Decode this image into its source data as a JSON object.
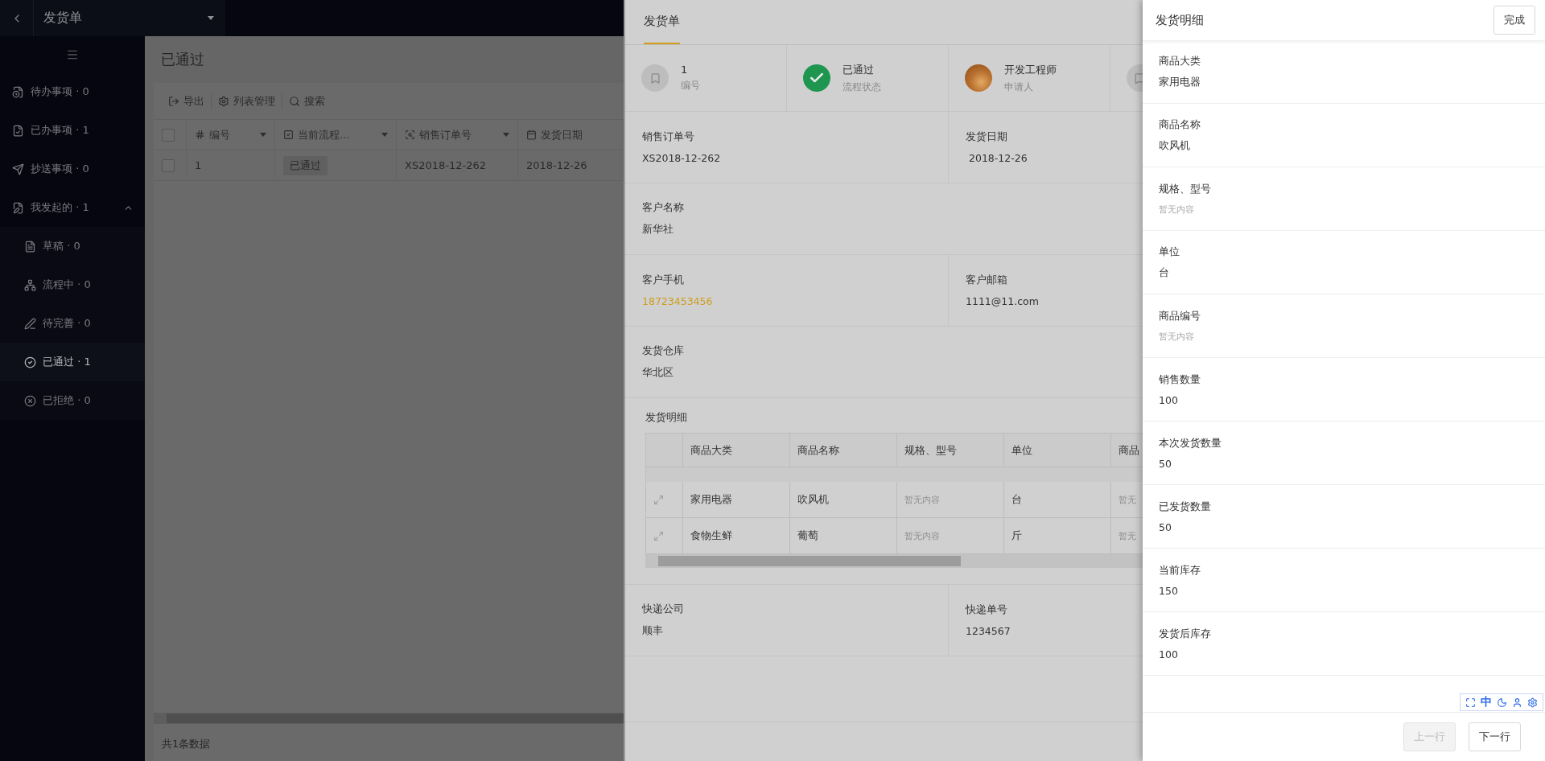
{
  "app_bar": {
    "title": "发货单"
  },
  "sidebar": {
    "items": [
      {
        "label": "待办事项 · 0",
        "selected": false
      },
      {
        "label": "已办事项 · 1",
        "selected": false
      },
      {
        "label": "抄送事项 · 0",
        "selected": false
      },
      {
        "label": "我发起的 · 1",
        "selected": false,
        "expanded": true,
        "children": [
          {
            "label": "草稿 · 0",
            "selected": false
          },
          {
            "label": "流程中 · 0",
            "selected": false
          },
          {
            "label": "待完善 · 0",
            "selected": false
          },
          {
            "label": "已通过 · 1",
            "selected": true
          },
          {
            "label": "已拒绝 · 0",
            "selected": false
          }
        ]
      }
    ]
  },
  "list_page": {
    "title": "已通过",
    "toolbar": [
      "导出",
      "列表管理",
      "搜索"
    ],
    "table": {
      "all_checked": false,
      "columns": [
        "编号",
        "当前流程...",
        "销售订单号",
        "发货日期"
      ],
      "rows": [
        {
          "checked": false,
          "cells": [
            "1",
            "已通过",
            "XS2018-12-262",
            "2018-12-26"
          ]
        }
      ]
    },
    "footer": "共1条数据"
  },
  "form_drawer": {
    "tabs": [
      {
        "label": "发货单",
        "selected": true
      }
    ],
    "summary": [
      {
        "kind": "number",
        "value": "1",
        "caption": "编号"
      },
      {
        "kind": "status",
        "value": "已通过",
        "caption": "流程状态"
      },
      {
        "kind": "user",
        "value": "开发工程师",
        "caption": "申请人"
      },
      {
        "kind": "note"
      }
    ],
    "sections": [
      {
        "kind": "fields",
        "fields": [
          {
            "label": "销售订单号",
            "value": "XS2018-12-262"
          },
          {
            "label": "发货日期",
            "value": " 2018-12-26"
          }
        ]
      },
      {
        "kind": "fields",
        "fields": [
          {
            "label": "客户名称",
            "value": "新华社"
          }
        ]
      },
      {
        "kind": "fields",
        "fields": [
          {
            "label": "客户手机",
            "value": "18723453456",
            "link": true
          },
          {
            "label": "客户邮箱",
            "value": "1111@11.com"
          }
        ]
      },
      {
        "kind": "fields",
        "fields": [
          {
            "label": "发货仓库",
            "value": "华北区"
          }
        ]
      },
      {
        "kind": "table",
        "title": "发货明细",
        "columns": [
          "商品大类",
          "商品名称",
          "规格、型号",
          "单位",
          "商品"
        ],
        "rows": [
          [
            {
              "text": "家用电器",
              "empty": false
            },
            {
              "text": "吹风机",
              "empty": false
            },
            {
              "text": "暂无内容",
              "empty": true
            },
            {
              "text": "台",
              "empty": false
            },
            {
              "text": "暂无",
              "empty": true
            }
          ],
          [
            {
              "text": "食物生鲜",
              "empty": false
            },
            {
              "text": "葡萄",
              "empty": false
            },
            {
              "text": "暂无内容",
              "empty": true
            },
            {
              "text": "斤",
              "empty": false
            },
            {
              "text": "暂无",
              "empty": true
            }
          ]
        ]
      },
      {
        "kind": "fields",
        "fields": [
          {
            "label": "快递公司",
            "value": "顺丰"
          },
          {
            "label": "快递单号",
            "value": "1234567"
          }
        ]
      }
    ]
  },
  "detail_drawer": {
    "title": "发货明细",
    "done_button": "完成",
    "fields": [
      {
        "label": "商品大类",
        "value": "家用电器",
        "empty": false
      },
      {
        "label": "商品名称",
        "value": "吹风机",
        "empty": false
      },
      {
        "label": "规格、型号",
        "value": "暂无内容",
        "empty": true
      },
      {
        "label": "单位",
        "value": "台",
        "empty": false
      },
      {
        "label": "商品编号",
        "value": "暂无内容",
        "empty": true
      },
      {
        "label": "销售数量",
        "value": "100",
        "empty": false
      },
      {
        "label": "本次发货数量",
        "value": "50",
        "empty": false
      },
      {
        "label": "已发货数量",
        "value": "50",
        "empty": false
      },
      {
        "label": "当前库存",
        "value": "150",
        "empty": false
      },
      {
        "label": "发货后库存",
        "value": "100",
        "empty": false
      }
    ],
    "buttons": [
      {
        "label": "上一行",
        "disabled": true
      },
      {
        "label": "下一行",
        "disabled": false
      }
    ]
  },
  "ime_toolbar": {
    "language": "中"
  }
}
